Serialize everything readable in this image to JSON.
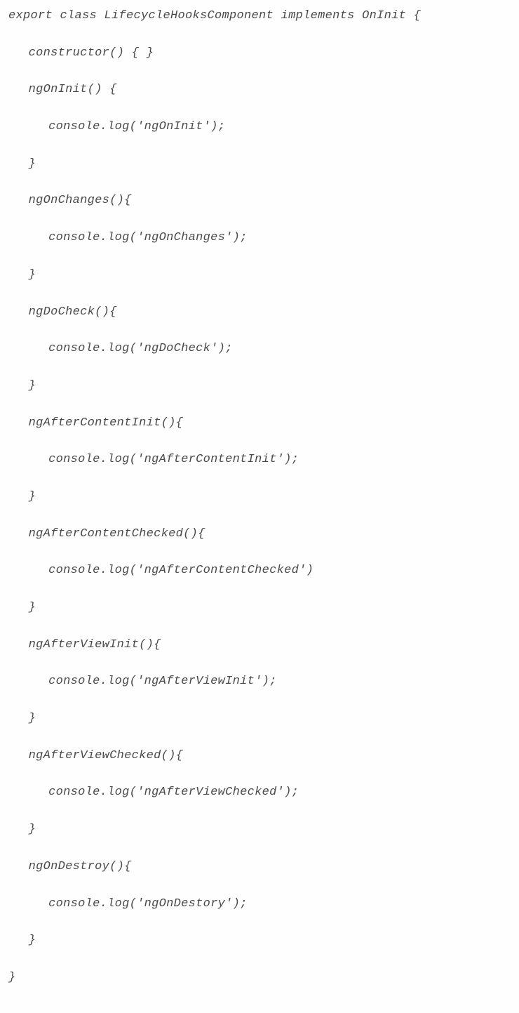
{
  "code": {
    "l1": "export class LifecycleHooksComponent implements OnInit {",
    "l2": "constructor() { }",
    "l3": "ngOnInit() {",
    "l4": "console.log('ngOnInit');",
    "l5": "}",
    "l6": "ngOnChanges(){",
    "l7": "console.log('ngOnChanges');",
    "l8": "}",
    "l9": "ngDoCheck(){",
    "l10": "console.log('ngDoCheck');",
    "l11": "}",
    "l12": "ngAfterContentInit(){",
    "l13": "console.log('ngAfterContentInit');",
    "l14": "}",
    "l15": "ngAfterContentChecked(){",
    "l16": "console.log('ngAfterContentChecked')",
    "l17": "}",
    "l18": "ngAfterViewInit(){",
    "l19": "console.log('ngAfterViewInit');",
    "l20": "}",
    "l21": "ngAfterViewChecked(){",
    "l22": "console.log('ngAfterViewChecked');",
    "l23": "}",
    "l24": "ngOnDestroy(){",
    "l25": "console.log('ngOnDestory');",
    "l26": "}",
    "l27": "}"
  }
}
